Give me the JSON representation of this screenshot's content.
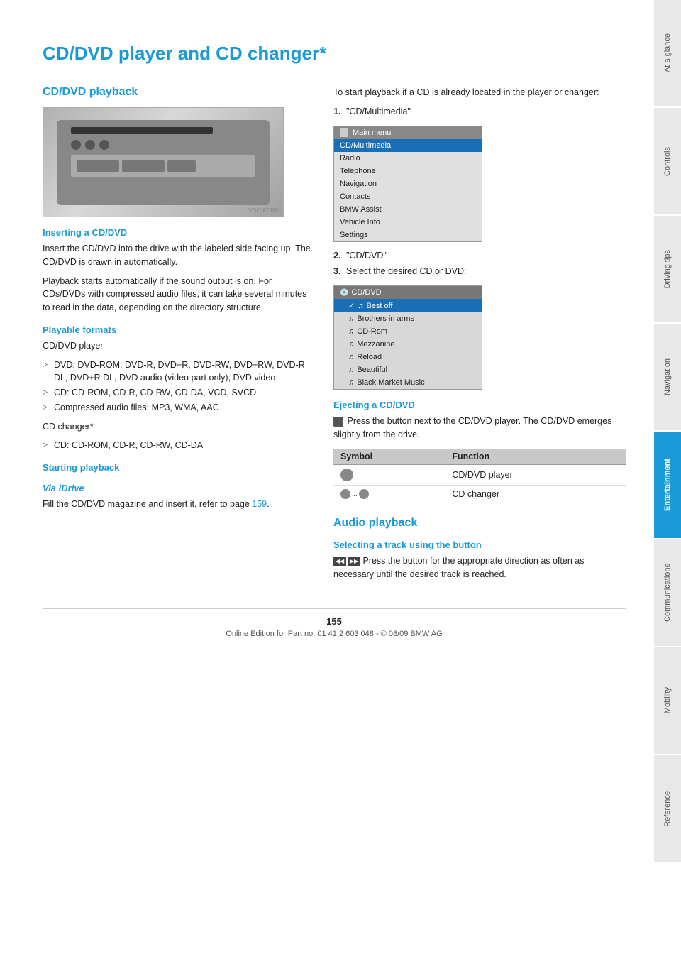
{
  "page": {
    "title": "CD/DVD player and CD changer*",
    "page_number": "155",
    "footer_text": "Online Edition for Part no. 01 41 2 603 048 - © 08/09 BMW AG"
  },
  "sidebar": {
    "tabs": [
      {
        "id": "at-a-glance",
        "label": "At a glance",
        "active": false
      },
      {
        "id": "controls",
        "label": "Controls",
        "active": false
      },
      {
        "id": "driving-tips",
        "label": "Driving tips",
        "active": false
      },
      {
        "id": "navigation",
        "label": "Navigation",
        "active": false
      },
      {
        "id": "entertainment",
        "label": "Entertainment",
        "active": true
      },
      {
        "id": "communications",
        "label": "Communications",
        "active": false
      },
      {
        "id": "mobility",
        "label": "Mobility",
        "active": false
      },
      {
        "id": "reference",
        "label": "Reference",
        "active": false
      }
    ]
  },
  "left_column": {
    "section_title": "CD/DVD playback",
    "inserting_title": "Inserting a CD/DVD",
    "inserting_text1": "Insert the CD/DVD into the drive with the labeled side facing up. The CD/DVD is drawn in automatically.",
    "inserting_text2": "Playback starts automatically if the sound output is on. For CDs/DVDs with compressed audio files, it can take several minutes to read in the data, depending on the directory structure.",
    "formats_title": "Playable formats",
    "formats_player_label": "CD/DVD player",
    "formats_dvd_bullet": "DVD: DVD-ROM, DVD-R, DVD+R, DVD-RW, DVD+RW, DVD-R DL, DVD+R DL, DVD audio (video part only), DVD video",
    "formats_cd_bullet": "CD: CD-ROM, CD-R, CD-RW, CD-DA, VCD, SVCD",
    "formats_compressed_bullet": "Compressed audio files: MP3, WMA, AAC",
    "formats_changer_label": "CD changer*",
    "formats_changer_cd_bullet": "CD: CD-ROM, CD-R, CD-RW, CD-DA",
    "starting_title": "Starting playback",
    "via_idrive_title": "Via iDrive",
    "via_idrive_text": "Fill the CD/DVD magazine and insert it, refer to page 159."
  },
  "right_column": {
    "intro_text": "To start playback if a CD is already located in the player or changer:",
    "step1": "\"CD/Multimedia\"",
    "step2": "\"CD/DVD\"",
    "step3": "Select the desired CD or DVD:",
    "main_menu": {
      "header": "Main menu",
      "items": [
        {
          "label": "CD/Multimedia",
          "highlighted": true
        },
        {
          "label": "Radio",
          "highlighted": false
        },
        {
          "label": "Telephone",
          "highlighted": false
        },
        {
          "label": "Navigation",
          "highlighted": false
        },
        {
          "label": "Contacts",
          "highlighted": false
        },
        {
          "label": "BMW Assist",
          "highlighted": false
        },
        {
          "label": "Vehicle Info",
          "highlighted": false
        },
        {
          "label": "Settings",
          "highlighted": false
        }
      ]
    },
    "cd_menu": {
      "header": "CD/DVD",
      "items": [
        {
          "label": "Best off",
          "highlighted": true,
          "icon": "✓"
        },
        {
          "label": "Brothers in arms",
          "highlighted": false,
          "icon": "♫"
        },
        {
          "label": "CD-Rom",
          "highlighted": false,
          "icon": "♫"
        },
        {
          "label": "Mezzanine",
          "highlighted": false,
          "icon": "♫"
        },
        {
          "label": "Reload",
          "highlighted": false,
          "icon": "♫"
        },
        {
          "label": "Beautiful",
          "highlighted": false,
          "icon": "♫"
        },
        {
          "label": "Black Market Music",
          "highlighted": false,
          "icon": "♫"
        }
      ]
    },
    "ejecting_title": "Ejecting a CD/DVD",
    "ejecting_text": "Press the button next to the CD/DVD player. The CD/DVD emerges slightly from the drive.",
    "table": {
      "col1": "Symbol",
      "col2": "Function",
      "rows": [
        {
          "symbol": "disc",
          "function": "CD/DVD player"
        },
        {
          "symbol": "changer",
          "function": "CD changer"
        }
      ]
    },
    "audio_section": {
      "title": "Audio playback",
      "selecting_title": "Selecting a track using the button",
      "selecting_text": "Press the button for the appropriate direction as often as necessary until the desired track is reached."
    }
  }
}
